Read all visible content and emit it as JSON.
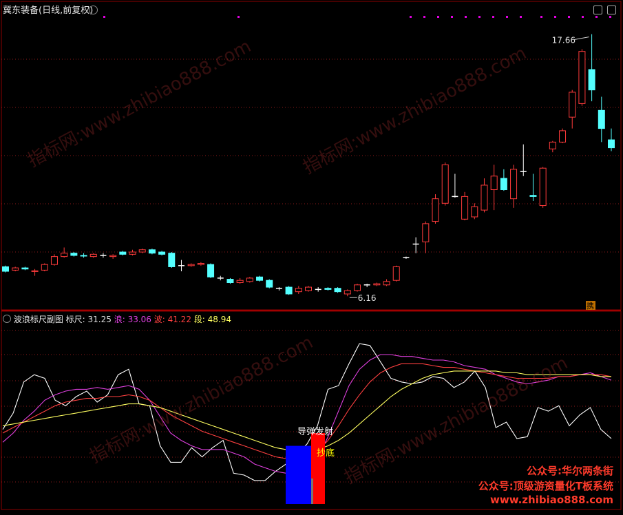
{
  "main": {
    "title": "冀东装备(日线,前复权)",
    "high_label": "17.66",
    "low_label": "6.16",
    "corner_tag": "携"
  },
  "sub": {
    "title": "波浪标尺副图",
    "items": [
      {
        "label": "标尺: 31.25",
        "color": "#e0e0e0"
      },
      {
        "label": "浪: 33.06",
        "color": "#e040e0"
      },
      {
        "label": "波: 41.22",
        "color": "#ff4040"
      },
      {
        "label": "段: 48.94",
        "color": "#ffff60"
      }
    ],
    "signal_missile": "导弹发射",
    "signal_bottom": "抄底"
  },
  "watermarks": [
    "指标网:www.zhibiao888.com",
    "指标网:www.zhibiao888.com",
    "指标网:www.zhibiao888.com",
    "指标网:www.zhibiao888.com"
  ],
  "promo": [
    "公众号:华尔两条街",
    "公众号:顶级游资量化T板系统",
    "www.zhibiao888.com"
  ],
  "chart_data": [
    {
      "type": "candlestick",
      "title": "冀东装备(日线,前复权)",
      "ylim": [
        5.5,
        18.5
      ],
      "annotations": [
        {
          "text": "17.66",
          "at": "high"
        },
        {
          "text": "6.16",
          "at": "low"
        }
      ],
      "candles": [
        {
          "o": 7.4,
          "c": 7.2,
          "h": 7.45,
          "l": 7.15
        },
        {
          "o": 7.25,
          "c": 7.35,
          "h": 7.4,
          "l": 7.2
        },
        {
          "o": 7.35,
          "c": 7.3,
          "h": 7.4,
          "l": 7.25
        },
        {
          "o": 7.2,
          "c": 7.22,
          "h": 7.3,
          "l": 7.0
        },
        {
          "o": 7.25,
          "c": 7.5,
          "h": 7.55,
          "l": 7.2
        },
        {
          "o": 7.5,
          "c": 7.85,
          "h": 7.95,
          "l": 7.45
        },
        {
          "o": 7.85,
          "c": 8.0,
          "h": 8.25,
          "l": 7.8
        },
        {
          "o": 8.0,
          "c": 7.9,
          "h": 8.05,
          "l": 7.85
        },
        {
          "o": 7.9,
          "c": 7.88,
          "h": 8.0,
          "l": 7.8
        },
        {
          "o": 7.85,
          "c": 7.95,
          "h": 8.0,
          "l": 7.8
        },
        {
          "o": 7.9,
          "c": 7.9,
          "h": 8.0,
          "l": 7.8
        },
        {
          "o": 7.85,
          "c": 7.9,
          "h": 7.95,
          "l": 7.75
        },
        {
          "o": 8.05,
          "c": 7.95,
          "h": 8.1,
          "l": 7.9
        },
        {
          "o": 7.95,
          "c": 8.05,
          "h": 8.15,
          "l": 7.9
        },
        {
          "o": 8.05,
          "c": 8.15,
          "h": 8.2,
          "l": 8.0
        },
        {
          "o": 8.15,
          "c": 8.0,
          "h": 8.2,
          "l": 7.95
        },
        {
          "o": 8.05,
          "c": 7.95,
          "h": 8.1,
          "l": 7.9
        },
        {
          "o": 8.0,
          "c": 7.4,
          "h": 8.05,
          "l": 7.35
        },
        {
          "o": 7.45,
          "c": 7.45,
          "h": 7.7,
          "l": 7.2
        },
        {
          "o": 7.45,
          "c": 7.5,
          "h": 7.55,
          "l": 7.4
        },
        {
          "o": 7.5,
          "c": 7.55,
          "h": 7.6,
          "l": 7.45
        },
        {
          "o": 7.5,
          "c": 6.95,
          "h": 7.55,
          "l": 6.9
        },
        {
          "o": 6.9,
          "c": 6.9,
          "h": 7.0,
          "l": 6.8
        },
        {
          "o": 6.85,
          "c": 6.7,
          "h": 6.9,
          "l": 6.65
        },
        {
          "o": 6.7,
          "c": 6.8,
          "h": 6.9,
          "l": 6.65
        },
        {
          "o": 6.75,
          "c": 6.9,
          "h": 6.95,
          "l": 6.7
        },
        {
          "o": 6.95,
          "c": 6.8,
          "h": 7.0,
          "l": 6.75
        },
        {
          "o": 6.8,
          "c": 6.5,
          "h": 6.85,
          "l": 6.45
        },
        {
          "o": 6.45,
          "c": 6.45,
          "h": 6.5,
          "l": 6.35
        },
        {
          "o": 6.5,
          "c": 6.2,
          "h": 6.55,
          "l": 6.16
        },
        {
          "o": 6.3,
          "c": 6.45,
          "h": 6.55,
          "l": 6.2
        },
        {
          "o": 6.35,
          "c": 6.5,
          "h": 6.55,
          "l": 6.3
        },
        {
          "o": 6.4,
          "c": 6.4,
          "h": 6.5,
          "l": 6.3
        },
        {
          "o": 6.45,
          "c": 6.4,
          "h": 6.5,
          "l": 6.35
        },
        {
          "o": 6.45,
          "c": 6.3,
          "h": 6.5,
          "l": 6.25
        },
        {
          "o": 6.2,
          "c": 6.35,
          "h": 6.4,
          "l": 6.1
        },
        {
          "o": 6.35,
          "c": 6.6,
          "h": 6.65,
          "l": 6.3
        },
        {
          "o": 6.6,
          "c": 6.6,
          "h": 6.65,
          "l": 6.5
        },
        {
          "o": 6.6,
          "c": 6.65,
          "h": 6.7,
          "l": 6.55
        },
        {
          "o": 6.6,
          "c": 6.75,
          "h": 6.85,
          "l": 6.55
        },
        {
          "o": 6.8,
          "c": 7.4,
          "h": 7.45,
          "l": 6.75
        },
        {
          "o": 7.8,
          "c": 7.8,
          "h": 7.85,
          "l": 7.75
        },
        {
          "o": 8.4,
          "c": 8.4,
          "h": 8.7,
          "l": 8.0
        },
        {
          "o": 8.5,
          "c": 9.3,
          "h": 9.4,
          "l": 8.0
        },
        {
          "o": 9.4,
          "c": 10.4,
          "h": 10.6,
          "l": 9.3
        },
        {
          "o": 10.2,
          "c": 11.9,
          "h": 12.0,
          "l": 10.1
        },
        {
          "o": 10.5,
          "c": 10.5,
          "h": 11.5,
          "l": 10.45
        },
        {
          "o": 9.5,
          "c": 10.5,
          "h": 10.7,
          "l": 9.45
        },
        {
          "o": 9.6,
          "c": 10.05,
          "h": 10.2,
          "l": 9.5
        },
        {
          "o": 9.9,
          "c": 11.0,
          "h": 11.3,
          "l": 9.8
        },
        {
          "o": 10.8,
          "c": 11.4,
          "h": 11.9,
          "l": 9.9
        },
        {
          "o": 11.3,
          "c": 10.8,
          "h": 11.7,
          "l": 10.75
        },
        {
          "o": 10.4,
          "c": 11.7,
          "h": 11.9,
          "l": 10.0
        },
        {
          "o": 11.6,
          "c": 11.6,
          "h": 12.8,
          "l": 11.4
        },
        {
          "o": 10.55,
          "c": 10.5,
          "h": 11.5,
          "l": 10.3
        },
        {
          "o": 10.1,
          "c": 11.75,
          "h": 11.8,
          "l": 10.0
        },
        {
          "o": 12.6,
          "c": 12.9,
          "h": 12.95,
          "l": 12.45
        },
        {
          "o": 12.9,
          "c": 13.4,
          "h": 13.5,
          "l": 12.85
        },
        {
          "o": 14.0,
          "c": 15.1,
          "h": 15.2,
          "l": 13.5
        },
        {
          "o": 14.6,
          "c": 16.9,
          "h": 17.0,
          "l": 14.5
        },
        {
          "o": 16.1,
          "c": 15.2,
          "h": 17.66,
          "l": 14.7
        },
        {
          "o": 14.3,
          "c": 13.5,
          "h": 14.9,
          "l": 12.9
        },
        {
          "o": 13.0,
          "c": 12.65,
          "h": 13.5,
          "l": 12.5
        }
      ]
    },
    {
      "type": "line",
      "title": "波浪标尺副图",
      "ylim": [
        0,
        100
      ],
      "series": [
        {
          "name": "标尺",
          "values": [
            42,
            51,
            68,
            72,
            70,
            58,
            55,
            60,
            63,
            57,
            61,
            72,
            75,
            56,
            55,
            33,
            24,
            24,
            32,
            27,
            32,
            36,
            18,
            17,
            14,
            14,
            19,
            23,
            28,
            34,
            44,
            64,
            66,
            78,
            89,
            88,
            79,
            70,
            68,
            67,
            68,
            71,
            70,
            65,
            68,
            74,
            65,
            43,
            46,
            37,
            38,
            54,
            52,
            55,
            44,
            50,
            54,
            42,
            37
          ],
          "color": "#ffffff"
        },
        {
          "name": "浪",
          "values": [
            35,
            40,
            47,
            52,
            58,
            61,
            63,
            64,
            64,
            65,
            64,
            65,
            66,
            64,
            58,
            49,
            40,
            36,
            33,
            31,
            31,
            31,
            29,
            27,
            23,
            21,
            19,
            18,
            18,
            20,
            26,
            38,
            52,
            66,
            75,
            80,
            83,
            83,
            82,
            82,
            81,
            80,
            80,
            79,
            77,
            76,
            75,
            72,
            70,
            68,
            67,
            68,
            69,
            71,
            71,
            72,
            73,
            71,
            69
          ],
          "color": "#e040e0"
        },
        {
          "name": "波",
          "values": [
            40,
            43,
            46,
            49,
            52,
            55,
            57,
            58,
            59,
            59,
            60,
            60,
            61,
            60,
            58,
            54,
            50,
            47,
            44,
            41,
            39,
            37,
            35,
            33,
            31,
            29,
            27,
            26,
            26,
            27,
            30,
            36,
            44,
            53,
            61,
            68,
            73,
            76,
            78,
            78,
            78,
            77,
            76,
            76,
            75,
            74,
            73,
            72,
            71,
            70,
            70,
            70,
            70,
            71,
            71,
            72,
            72,
            72,
            71
          ],
          "color": "#ff4040"
        },
        {
          "name": "段",
          "values": [
            44,
            45,
            46,
            47,
            48,
            49,
            50,
            51,
            52,
            53,
            54,
            55,
            56,
            56,
            55,
            54,
            52,
            50,
            48,
            46,
            44,
            42,
            40,
            38,
            36,
            34,
            32,
            31,
            30,
            30,
            31,
            33,
            36,
            40,
            45,
            50,
            55,
            60,
            64,
            67,
            70,
            72,
            73,
            74,
            74,
            74,
            74,
            74,
            73,
            73,
            72,
            72,
            72,
            72,
            72,
            72,
            72,
            71,
            71
          ],
          "color": "#ffff60"
        }
      ],
      "signals": [
        {
          "label": "导弹发射",
          "color": "#0000ff",
          "value": 33
        },
        {
          "label": "抄底",
          "color": "#ff0000",
          "value": 40
        }
      ]
    }
  ]
}
